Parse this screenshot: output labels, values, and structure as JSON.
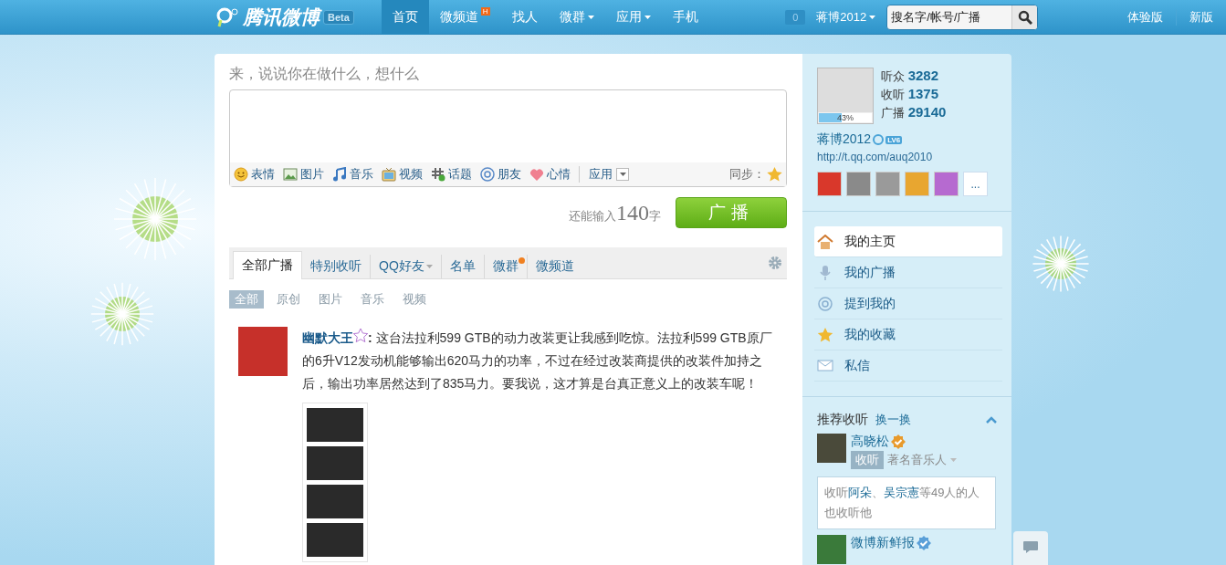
{
  "top_nav": {
    "logo": "腾讯微博",
    "beta": "Beta",
    "items": [
      {
        "label": "首页",
        "selected": true,
        "dropdown": false
      },
      {
        "label": "微频道",
        "selected": false,
        "dropdown": false,
        "badge": "H"
      },
      {
        "label": "找人",
        "selected": false,
        "dropdown": false
      },
      {
        "label": "微群",
        "selected": false,
        "dropdown": true
      },
      {
        "label": "应用",
        "selected": false,
        "dropdown": true
      },
      {
        "label": "手机",
        "selected": false,
        "dropdown": false
      }
    ],
    "notify_count": "0",
    "user": "蒋博2012",
    "search_placeholder": "搜名字/帐号/广播",
    "links": [
      "体验版",
      "新版"
    ]
  },
  "composer": {
    "prompt": "来，说说你在做什么，想什么",
    "tools": [
      {
        "kind": "emoji",
        "label": "表情"
      },
      {
        "kind": "image",
        "label": "图片"
      },
      {
        "kind": "music",
        "label": "音乐"
      },
      {
        "kind": "video",
        "label": "视频"
      },
      {
        "kind": "topic",
        "label": "话题"
      },
      {
        "kind": "friend",
        "label": "朋友"
      },
      {
        "kind": "mood",
        "label": "心情"
      }
    ],
    "apps": "应用",
    "sync": "同步：",
    "counter_prefix": "还能输入",
    "count": "140",
    "counter_suffix": "字",
    "submit": "广播"
  },
  "feed_tabs": [
    {
      "label": "全部广播",
      "selected": true,
      "dropdown": false,
      "dot": false
    },
    {
      "label": "特别收听",
      "selected": false,
      "dropdown": false,
      "dot": false
    },
    {
      "label": "QQ好友",
      "selected": false,
      "dropdown": true,
      "dot": false
    },
    {
      "label": "名单",
      "selected": false,
      "dropdown": false,
      "dot": false
    },
    {
      "label": "微群",
      "selected": false,
      "dropdown": false,
      "dot": true
    },
    {
      "label": "微频道",
      "selected": false,
      "dropdown": false,
      "dot": false
    }
  ],
  "filters": [
    {
      "label": "全部",
      "selected": true
    },
    {
      "label": "原创",
      "selected": false
    },
    {
      "label": "图片",
      "selected": false
    },
    {
      "label": "音乐",
      "selected": false
    },
    {
      "label": "视频",
      "selected": false
    }
  ],
  "posts": [
    {
      "author": "幽默大王",
      "colon": ":",
      "text": "这台法拉利599 GTB的动力改装更让我感到吃惊。法拉利599 GTB原厂的6升V12发动机能够输出620马力的功率，不过在经过改装商提供的改装件加持之后，输出功率居然达到了835马力。要我说，这才算是台真正意义上的改装车呢！"
    }
  ],
  "profile": {
    "progress": "43%",
    "level": 0.43,
    "stats": [
      {
        "label": "听众",
        "value": "3282"
      },
      {
        "label": "收听",
        "value": "1375"
      },
      {
        "label": "广播",
        "value": "29140"
      }
    ],
    "name": "蒋博2012",
    "level_badge": "LV6",
    "url": "http://t.qq.com/auq2010",
    "medals": [
      {
        "color": "#d9382b"
      },
      {
        "color": "#8a8a8a"
      },
      {
        "color": "#9a9a9a"
      },
      {
        "color": "#e8a630"
      },
      {
        "color": "#b66ad0"
      }
    ],
    "more": "..."
  },
  "side_nav": [
    {
      "kind": "home",
      "label": "我的主页",
      "selected": true
    },
    {
      "kind": "mic",
      "label": "我的广播",
      "selected": false
    },
    {
      "kind": "at",
      "label": "提到我的",
      "selected": false
    },
    {
      "kind": "star",
      "label": "我的收藏",
      "selected": false
    },
    {
      "kind": "mail",
      "label": "私信",
      "selected": false
    }
  ],
  "recommend": {
    "title": "推荐收听",
    "refresh": "换一换",
    "people": [
      {
        "name": "高晓松",
        "color": "#e89a2c",
        "follow": "收听",
        "desc": "著名音乐人",
        "tip": {
          "lead": "收听",
          "links": [
            "阿朵",
            "吴宗憲"
          ],
          "sep": "、",
          "tail": "等49人的人也收听他"
        }
      },
      {
        "name": "微博新鲜报",
        "color": "#5a9fd8"
      }
    ]
  }
}
